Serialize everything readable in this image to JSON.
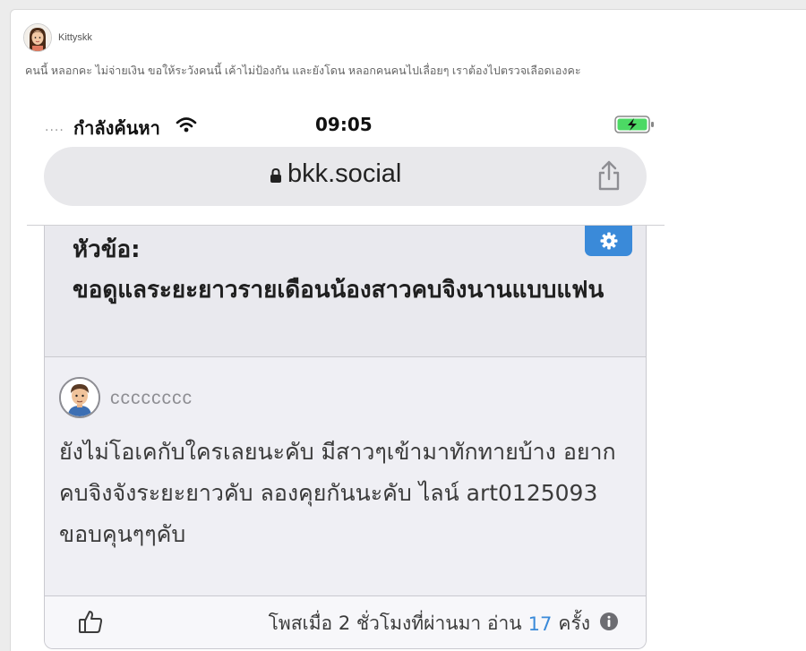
{
  "post": {
    "author": "Kittyskk",
    "caption": "คนนี้ หลอกคะ ไม่จ่ายเงิน ขอให้ระวังคนนี้ เค้าไม่ป้องกัน และยังโดน หลอกคนคนไปเลื่อยๆ เราต้องไปตรวจเลือดเองคะ"
  },
  "phone": {
    "status": {
      "signal": "....",
      "carrier": "กำลังค้นหา",
      "time": "09:05"
    },
    "url": "bkk.social",
    "topic_label": "หัวข้อ:",
    "topic_title": "ขอดูแลระยะยาวรายเดือนน้องสาวคบจิงนานแบบแฟน",
    "reply": {
      "username": "cccccccc",
      "body": "ยังไม่โอเคกับใครเลยนะคับ มีสาวๆเข้ามาทักทายบ้าง อยากคบจิงจังระยะยาวคับ ลองคุยกันนะคับ ไลน์  art0125093 ขอบคุนๆๆคับ"
    },
    "footer": {
      "posted": "โพสเมื่อ 2 ชั่วโมงที่ผ่านมา อ่าน",
      "read_count": "17",
      "read_unit": "ครั้ง"
    }
  },
  "colors": {
    "accent": "#3a8ad9",
    "battery": "#4cd964"
  }
}
